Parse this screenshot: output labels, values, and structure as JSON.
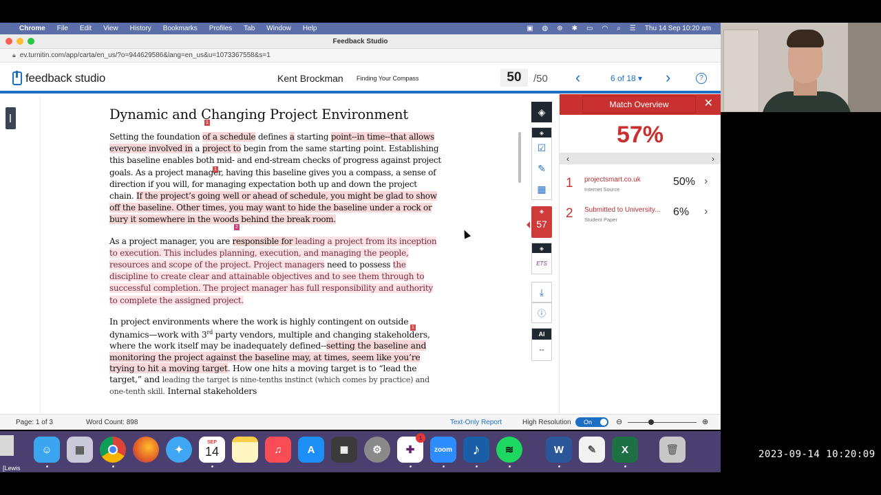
{
  "menubar": {
    "items": [
      "Chrome",
      "File",
      "Edit",
      "View",
      "History",
      "Bookmarks",
      "Profiles",
      "Tab",
      "Window",
      "Help"
    ],
    "clock": "Thu 14 Sep  10:20 am"
  },
  "browser": {
    "window_title": "Feedback Studio",
    "url": "ev.turnitin.com/app/carta/en_us/?o=944629586&lang=en_us&u=1073367558&s=1"
  },
  "header": {
    "logo": "feedback studio",
    "student": "Kent Brockman",
    "assignment": "Finding Your Compass",
    "grade": "50",
    "grade_total": "/50",
    "position": "6 of 18 ▾"
  },
  "document": {
    "heading": "Dynamic and Changing Project Environment",
    "p1": {
      "a": "Setting the foundation ",
      "b": "of a schedule",
      "c": " defines ",
      "d": "a",
      "e": " starting ",
      "f": "point--in time--that allows everyone involved in",
      "g": " a ",
      "h": "project to",
      "i": " begin from the same starting point. Establishing this baseline enables both mid- and end-stream checks of progress against project goals.  As a project manager, having this baseline gives you a compass, a sense of direction if you will, for managing expectation both up and down the project chain.  ",
      "j": "If the project’s going well or ahead of schedule, you might be glad to show off the baseline. Other times, you may want to hide the baseline under a rock or bury it somewhere in the woods behind the break room."
    },
    "p2": {
      "a": "As a project manager, you are ",
      "b": "responsible for ",
      "c": "leading a project from its inception to execution. This includes planning, execution, and managing the people, resources and scope of the project. Project managers",
      "d": " need to possess ",
      "e": "the discipline to create clear and attainable objectives and to see them through to successful completion. The project manager has full responsibility and authority to complete the assigned project."
    },
    "p3": {
      "a": "In project environments where the work is highly contingent on outside dynamics—work with 3",
      "sup": "rd",
      "b": " party vendors, multiple and changing stakeholders, where the work itself may be inadequately defined--",
      "c": "setting the baseline and monitoring the project against the baseline may, at times, seem like you’re trying to hit a moving target",
      "d": ". How one hits a moving target is to “lead the target,” and ",
      "e": "leading the target is nine-tenths instinct (which comes by practice) and one-tenth skill.",
      "f": "  Internal stakeholders"
    },
    "flags": [
      "1",
      "1",
      "2",
      "1"
    ]
  },
  "rail": {
    "similarity": "57",
    "ai_label": "AI",
    "ai_value": "--"
  },
  "panel": {
    "title": "Match Overview",
    "percent": "57%",
    "sources": [
      {
        "index": "1",
        "name": "projectsmart.co.uk",
        "type": "Internet Source",
        "percent": "50%"
      },
      {
        "index": "2",
        "name": "Submitted to University...",
        "type": "Student Paper",
        "percent": "6%"
      }
    ]
  },
  "statusbar": {
    "page": "Page: 1 of 3",
    "word_count": "Word Count: 898",
    "text_only": "Text-Only Report",
    "high_res": "High Resolution",
    "toggle": "On"
  },
  "dock": {
    "calendar_month": "SEP",
    "calendar_day": "14",
    "slack_badge": "1",
    "zoom_label": "zoom",
    "left_label": "[Lewis"
  },
  "timestamp": "2023-09-14 10:20:09",
  "colors": {
    "accent": "#1d6fc4",
    "match_red": "#c8312f",
    "match_pink": "#f7d7d7",
    "match2_pink": "#fbe3e6"
  }
}
